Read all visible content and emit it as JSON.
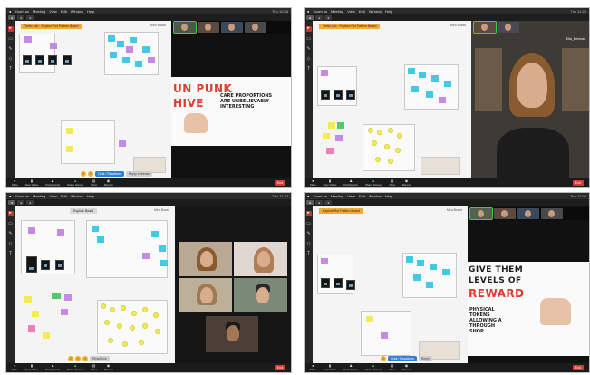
{
  "colors": {
    "note_cyan": "#43c8e6",
    "note_purple": "#c58ae8",
    "note_yellow": "#f4ec57",
    "note_green": "#56c86c",
    "title_tag_orange": "#f5a93a",
    "share_green": "#35d04a",
    "end_red": "#d93b3b"
  },
  "icons": [
    "apple-icon",
    "cursor-icon",
    "sticky-note-icon",
    "pen-icon",
    "shape-icon",
    "text-icon",
    "emoji-icon",
    "mic-icon",
    "video-icon",
    "share-screen-icon",
    "chat-icon",
    "participants-icon",
    "record-icon"
  ],
  "panels": [
    {
      "menu": [
        "Zoom.us",
        "Meeting",
        "View",
        "Edit",
        "Window",
        "Help"
      ],
      "clock": "Thu 10:56",
      "board_title": "Trello Lab · Explore RoI Pattern Board",
      "zoom": "Miro Board",
      "sketch_big_1": "UN PUNK",
      "sketch_big_2": "HIVE",
      "sketch_small": "CARE PROPORTIONS\nARE UNBELIEVABLY\nINTERESTING",
      "chat_label": "Chat / Reactions",
      "chat_alt": "Reply in thread",
      "footer": [
        "Mute",
        "Stop Video",
        "Participants",
        "Share Screen",
        "Chat",
        "Record"
      ],
      "end_label": "End"
    },
    {
      "menu": [
        "Zoom.us",
        "Meeting",
        "View",
        "Edit",
        "Window",
        "Help"
      ],
      "clock": "Thu 11:20",
      "board_title": "Trello Lab · Explore RoI Pattern Board",
      "zoom": "Miro Board",
      "speaker_name": "Ella_Brennan",
      "footer": [
        "Mute",
        "Stop Video",
        "Participants",
        "Share Screen",
        "Chat",
        "Record"
      ],
      "end_label": "End"
    },
    {
      "menu": [
        "Zoom.us",
        "Meeting",
        "View",
        "Edit",
        "Window",
        "Help"
      ],
      "clock": "Thu 11:47",
      "board_title": "Explore Board",
      "zoom": "Miro Board",
      "chat_label": "Reactions",
      "footer": [
        "Mute",
        "Stop Video",
        "Participants",
        "Share Screen",
        "Chat",
        "Record"
      ],
      "end_label": "End"
    },
    {
      "menu": [
        "Zoom.us",
        "Meeting",
        "View",
        "Edit",
        "Window",
        "Help"
      ],
      "clock": "Thu 12:05",
      "board_title": "Explore RoI Pattern Board",
      "zoom": "Miro Board",
      "sketch_big_1": "GIVE THEM",
      "sketch_big_2": "LEVELS OF",
      "sketch_big_3": "REWARD",
      "sketch_small": "PHYSICAL\nTOKENS\nALLOWING A\nTHROUGH\nSHOP",
      "chat_label": "Chat / Reactions",
      "chat_alt": "Reply",
      "footer": [
        "Mute",
        "Stop Video",
        "Participants",
        "Share Screen",
        "Chat",
        "Record"
      ],
      "end_label": "End"
    }
  ]
}
